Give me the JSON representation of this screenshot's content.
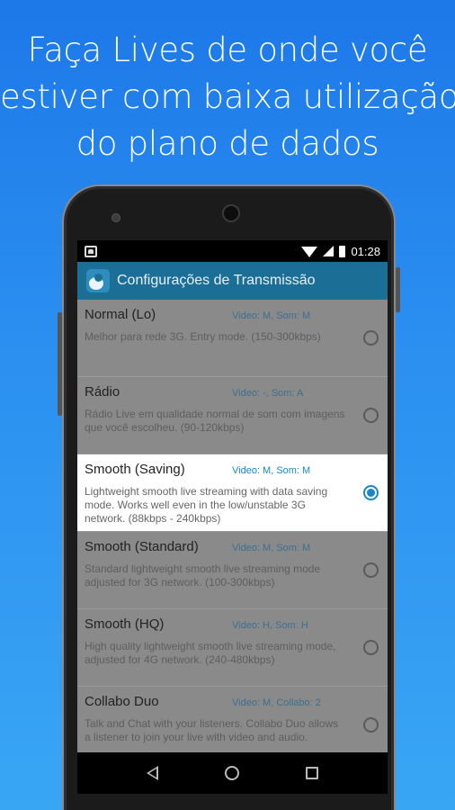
{
  "headline": {
    "line1": "Faça Lives de onde você",
    "line2": "estiver com baixa utilização",
    "line3": "do plano de dados"
  },
  "statusbar": {
    "time": "01:28",
    "icons": [
      "home-icon",
      "wifi-icon",
      "signal-icon",
      "battery-icon"
    ]
  },
  "appbar": {
    "title": "Configurações de Transmissão",
    "icon": "app-logo-icon"
  },
  "modes": [
    {
      "title": "Normal (Lo)",
      "meta": "Video: M, Som: M",
      "desc": "Melhor para rede 3G. Entry mode. (150-300kbps)",
      "selected": false
    },
    {
      "title": "Rádio",
      "meta": "Video: -, Som: A",
      "desc": "Rádio Live em qualidade normal de som com imagens que você escolheu. (90-120kbps)",
      "selected": false
    },
    {
      "title": "Smooth (Saving)",
      "meta": "Video: M, Som: M",
      "desc": "Lightweight smooth live streaming with data saving mode. Works well even in the low/unstable 3G network. (88kbps - 240kbps)",
      "selected": true
    },
    {
      "title": "Smooth (Standard)",
      "meta": "Video: M, Som: M",
      "desc": "Standard lightweight smooth live streaming mode adjusted for 3G network. (100-300kbps)",
      "selected": false
    },
    {
      "title": "Smooth (HQ)",
      "meta": "Video: H, Som: H",
      "desc": "High quality lightweight smooth live streaming mode, adjusted for 4G network. (240-480kbps)",
      "selected": false
    },
    {
      "title": "Collabo Duo",
      "meta": "Video: M, Collabo: 2",
      "desc": "Talk and Chat with your listeners. Collabo Duo allows a listener to join your live with video and audio.",
      "selected": false
    }
  ],
  "navbar": {
    "icons": [
      "back-icon",
      "home-icon",
      "recents-icon"
    ]
  },
  "colors": {
    "background_top": "#1d78e8",
    "background_bottom": "#39a6f4",
    "appbar": "#1b6f96",
    "accent": "#1a86c7"
  }
}
